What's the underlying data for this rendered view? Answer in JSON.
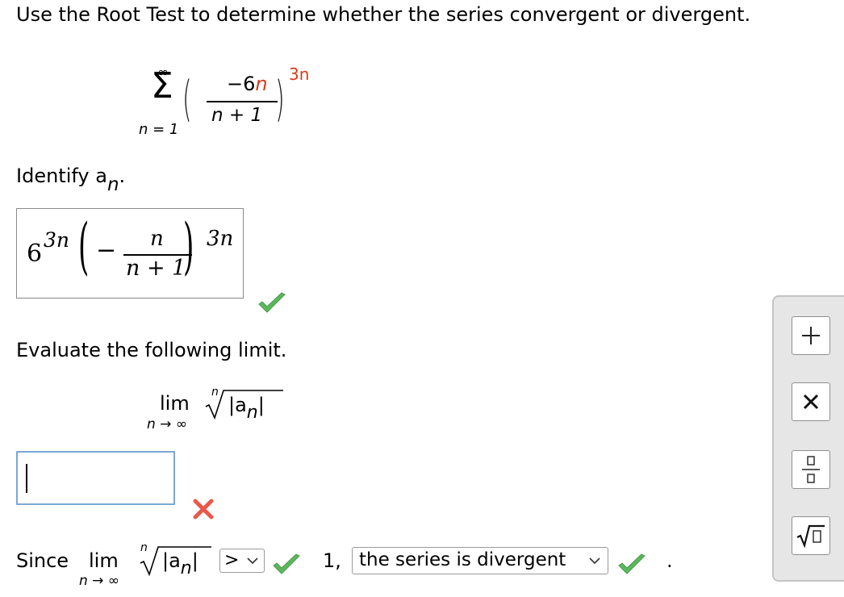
{
  "question": {
    "prompt": "Use the Root Test to determine whether the series convergent or divergent."
  },
  "series": {
    "sum_upper": "∞",
    "sum_lower": "n = 1",
    "numerator_coef": "−6",
    "numerator_var": "n",
    "denominator": "n + 1",
    "exponent": "3n"
  },
  "step1": {
    "label_text": "Identify a",
    "label_sub": "n",
    "label_end": ".",
    "answer": {
      "base": "6",
      "base_exp": "3n",
      "minus": "−",
      "frac_num": "n",
      "frac_den": "n + 1",
      "outer_exp": "3n"
    },
    "status": "correct"
  },
  "step2": {
    "label": "Evaluate the following limit.",
    "lim": "lim",
    "lim_sub": "n → ∞",
    "root_index": "n",
    "radicand": "|a",
    "radicand_sub": "n",
    "radicand_end": "|",
    "input_value": "",
    "status": "incorrect"
  },
  "conclusion": {
    "since": "Since",
    "lim": "lim",
    "lim_sub": "n → ∞",
    "root_index": "n",
    "radicand": "|a",
    "radicand_sub": "n",
    "radicand_end": "|",
    "comparison_selected": ">",
    "one_text": "1,",
    "result_selected": "the series is divergent",
    "end": "."
  },
  "palette": {
    "buttons": [
      "plus-icon",
      "times-icon",
      "fraction-icon",
      "sqrt-icon"
    ]
  },
  "colors": {
    "check_green": "#5cb85c",
    "cross_red": "#e8594a",
    "input_border": "#7aa7d8",
    "accent_red": "#d93a1e"
  }
}
